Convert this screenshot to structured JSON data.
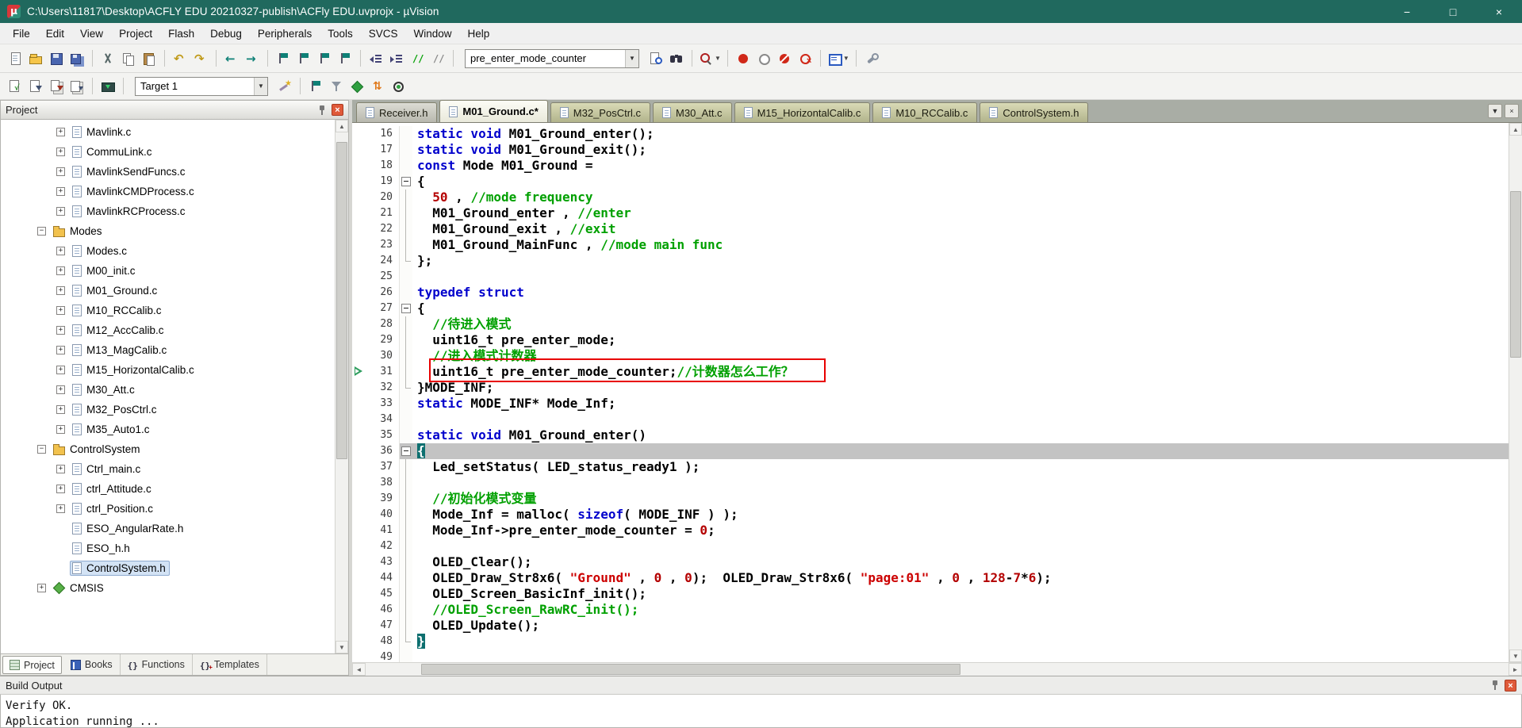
{
  "window": {
    "title": "C:\\Users\\11817\\Desktop\\ACFLY EDU 20210327-publish\\ACFly EDU.uvprojx - µVision",
    "app_glyph": "µ",
    "controls": {
      "minimize": "−",
      "maximize": "□",
      "close": "×"
    }
  },
  "glyphs": {
    "dropdown": "▼",
    "up_arrow": "▲",
    "down_arrow": "▼",
    "left_arrow": "◄",
    "right_arrow": "►",
    "close_small": "×"
  },
  "menu": [
    "File",
    "Edit",
    "View",
    "Project",
    "Flash",
    "Debug",
    "Peripherals",
    "Tools",
    "SVCS",
    "Window",
    "Help"
  ],
  "toolbar_main": {
    "groups_left": [
      [
        "new-file",
        "open-file",
        "save",
        "save-all"
      ],
      [
        "cut",
        "copy",
        "paste"
      ],
      [
        "undo",
        "redo"
      ],
      [
        "navigate-back",
        "navigate-forward"
      ],
      [
        "bookmark-toggle",
        "bookmark-prev",
        "bookmark-next",
        "bookmark-clear"
      ],
      [
        "unindent",
        "indent",
        "comment",
        "uncomment"
      ]
    ],
    "symbol_box": {
      "value": "pre_enter_mode_counter"
    },
    "groups_right": [
      [
        "find-in-files",
        "binoculars"
      ],
      [
        "incremental-find"
      ],
      [
        "breakpoint-toggle",
        "breakpoint-enable",
        "breakpoint-disable-all",
        "breakpoint-kill-all"
      ],
      [
        "memory-window"
      ],
      [
        "configure-tools"
      ]
    ]
  },
  "toolbar_build": {
    "groups_left": [
      [
        "translate",
        "build",
        "rebuild",
        "batch-build"
      ],
      [
        "load"
      ]
    ],
    "target_box": {
      "value": "Target 1"
    },
    "groups_right": [
      [
        "options-wand"
      ],
      [
        "file-extensions-flag",
        "filter",
        "debug-diamond",
        "swap-arrows",
        "debug-target"
      ]
    ]
  },
  "project_panel": {
    "title": "Project",
    "tree": [
      {
        "label": "Mavlink.c",
        "depth": 2,
        "icon": "doc",
        "expander": "plus"
      },
      {
        "label": "CommuLink.c",
        "depth": 2,
        "icon": "doc",
        "expander": "plus"
      },
      {
        "label": "MavlinkSendFuncs.c",
        "depth": 2,
        "icon": "doc",
        "expander": "plus"
      },
      {
        "label": "MavlinkCMDProcess.c",
        "depth": 2,
        "icon": "doc",
        "expander": "plus"
      },
      {
        "label": "MavlinkRCProcess.c",
        "depth": 2,
        "icon": "doc",
        "expander": "plus"
      },
      {
        "label": "Modes",
        "depth": 1,
        "icon": "folder",
        "expander": "minus"
      },
      {
        "label": "Modes.c",
        "depth": 2,
        "icon": "doc",
        "expander": "plus"
      },
      {
        "label": "M00_init.c",
        "depth": 2,
        "icon": "doc",
        "expander": "plus"
      },
      {
        "label": "M01_Ground.c",
        "depth": 2,
        "icon": "doc",
        "expander": "plus"
      },
      {
        "label": "M10_RCCalib.c",
        "depth": 2,
        "icon": "doc",
        "expander": "plus"
      },
      {
        "label": "M12_AccCalib.c",
        "depth": 2,
        "icon": "doc",
        "expander": "plus"
      },
      {
        "label": "M13_MagCalib.c",
        "depth": 2,
        "icon": "doc",
        "expander": "plus"
      },
      {
        "label": "M15_HorizontalCalib.c",
        "depth": 2,
        "icon": "doc",
        "expander": "plus"
      },
      {
        "label": "M30_Att.c",
        "depth": 2,
        "icon": "doc",
        "expander": "plus"
      },
      {
        "label": "M32_PosCtrl.c",
        "depth": 2,
        "icon": "doc",
        "expander": "plus"
      },
      {
        "label": "M35_Auto1.c",
        "depth": 2,
        "icon": "doc",
        "expander": "plus"
      },
      {
        "label": "ControlSystem",
        "depth": 1,
        "icon": "folder",
        "expander": "minus"
      },
      {
        "label": "Ctrl_main.c",
        "depth": 2,
        "icon": "doc",
        "expander": "plus"
      },
      {
        "label": "ctrl_Attitude.c",
        "depth": 2,
        "icon": "doc",
        "expander": "plus"
      },
      {
        "label": "ctrl_Position.c",
        "depth": 2,
        "icon": "doc",
        "expander": "plus"
      },
      {
        "label": "ESO_AngularRate.h",
        "depth": 2,
        "icon": "doc",
        "expander": "none"
      },
      {
        "label": "ESO_h.h",
        "depth": 2,
        "icon": "doc",
        "expander": "none"
      },
      {
        "label": "ControlSystem.h",
        "depth": 2,
        "icon": "doc",
        "expander": "none",
        "selected": true
      },
      {
        "label": "CMSIS",
        "depth": 1,
        "icon": "cmsis",
        "expander": "plus"
      }
    ],
    "workspace_tabs": [
      {
        "label": "Project",
        "icon": "project",
        "active": true
      },
      {
        "label": "Books",
        "icon": "books"
      },
      {
        "label": "Functions",
        "icon": "functions"
      },
      {
        "label": "Templates",
        "icon": "templates"
      }
    ]
  },
  "editor": {
    "tabs": [
      {
        "label": "Receiver.h",
        "style": "gray"
      },
      {
        "label": "M01_Ground.c*",
        "style": "active"
      },
      {
        "label": "M32_PosCtrl.c",
        "style": "olive"
      },
      {
        "label": "M30_Att.c",
        "style": "olive"
      },
      {
        "label": "M15_HorizontalCalib.c",
        "style": "olive"
      },
      {
        "label": "M10_RCCalib.c",
        "style": "olive"
      },
      {
        "label": "ControlSystem.h",
        "style": "olive"
      }
    ],
    "current_line": 36,
    "annotated_line": 31,
    "code": [
      {
        "n": 16,
        "f": "",
        "seg": [
          [
            "k",
            "static void"
          ],
          [
            "p",
            " M01_Ground_enter();"
          ]
        ]
      },
      {
        "n": 17,
        "f": "",
        "seg": [
          [
            "k",
            "static void"
          ],
          [
            "p",
            " M01_Ground_exit();"
          ]
        ]
      },
      {
        "n": 18,
        "f": "",
        "seg": [
          [
            "k",
            "const"
          ],
          [
            "p",
            " Mode M01_Ground = "
          ]
        ]
      },
      {
        "n": 19,
        "f": "s",
        "seg": [
          [
            "p",
            "{"
          ]
        ]
      },
      {
        "n": 20,
        "f": "m",
        "seg": [
          [
            "p",
            "  "
          ],
          [
            "n",
            "50"
          ],
          [
            "p",
            " , "
          ],
          [
            "c",
            "//mode frequency"
          ]
        ]
      },
      {
        "n": 21,
        "f": "m",
        "seg": [
          [
            "p",
            "  M01_Ground_enter , "
          ],
          [
            "c",
            "//enter"
          ]
        ]
      },
      {
        "n": 22,
        "f": "m",
        "seg": [
          [
            "p",
            "  M01_Ground_exit , "
          ],
          [
            "c",
            "//exit"
          ]
        ]
      },
      {
        "n": 23,
        "f": "m",
        "seg": [
          [
            "p",
            "  M01_Ground_MainFunc , "
          ],
          [
            "c",
            "//mode main func"
          ]
        ]
      },
      {
        "n": 24,
        "f": "e",
        "seg": [
          [
            "p",
            "};"
          ]
        ]
      },
      {
        "n": 25,
        "f": "",
        "seg": []
      },
      {
        "n": 26,
        "f": "",
        "seg": [
          [
            "k",
            "typedef struct"
          ]
        ]
      },
      {
        "n": 27,
        "f": "s",
        "seg": [
          [
            "p",
            "{"
          ]
        ]
      },
      {
        "n": 28,
        "f": "m",
        "seg": [
          [
            "p",
            "  "
          ],
          [
            "c",
            "//待进入模式"
          ]
        ]
      },
      {
        "n": 29,
        "f": "m",
        "seg": [
          [
            "p",
            "  uint16_t pre_enter_mode;"
          ]
        ]
      },
      {
        "n": 30,
        "f": "m",
        "seg": [
          [
            "p",
            "  "
          ],
          [
            "c",
            "//进入模式计数器"
          ]
        ]
      },
      {
        "n": 31,
        "f": "m",
        "seg": [
          [
            "p",
            "  uint16_t pre_enter_mode_counter;"
          ],
          [
            "c",
            "//计数器怎么工作？"
          ]
        ]
      },
      {
        "n": 32,
        "f": "e",
        "seg": [
          [
            "p",
            "}MODE_INF;"
          ]
        ]
      },
      {
        "n": 33,
        "f": "",
        "seg": [
          [
            "k",
            "static"
          ],
          [
            "p",
            " MODE_INF* Mode_Inf;"
          ]
        ]
      },
      {
        "n": 34,
        "f": "",
        "seg": []
      },
      {
        "n": 35,
        "f": "",
        "seg": [
          [
            "k",
            "static void"
          ],
          [
            "p",
            " M01_Ground_enter()"
          ]
        ]
      },
      {
        "n": 36,
        "f": "s",
        "seg": [
          [
            "bh",
            "{"
          ]
        ]
      },
      {
        "n": 37,
        "f": "m",
        "seg": [
          [
            "p",
            "  Led_setStatus( LED_status_ready1 );"
          ]
        ]
      },
      {
        "n": 38,
        "f": "m",
        "seg": []
      },
      {
        "n": 39,
        "f": "m",
        "seg": [
          [
            "p",
            "  "
          ],
          [
            "c",
            "//初始化模式变量"
          ]
        ]
      },
      {
        "n": 40,
        "f": "m",
        "seg": [
          [
            "p",
            "  Mode_Inf = malloc( "
          ],
          [
            "k",
            "sizeof"
          ],
          [
            "p",
            "( MODE_INF ) );"
          ]
        ]
      },
      {
        "n": 41,
        "f": "m",
        "seg": [
          [
            "p",
            "  Mode_Inf->pre_enter_mode_counter = "
          ],
          [
            "n",
            "0"
          ],
          [
            "p",
            ";"
          ]
        ]
      },
      {
        "n": 42,
        "f": "m",
        "seg": []
      },
      {
        "n": 43,
        "f": "m",
        "seg": [
          [
            "p",
            "  OLED_Clear();"
          ]
        ]
      },
      {
        "n": 44,
        "f": "m",
        "seg": [
          [
            "p",
            "  OLED_Draw_Str8x6( "
          ],
          [
            "s",
            "\"Ground\""
          ],
          [
            "p",
            " , "
          ],
          [
            "n",
            "0"
          ],
          [
            "p",
            " , "
          ],
          [
            "n",
            "0"
          ],
          [
            "p",
            ");  OLED_Draw_Str8x6( "
          ],
          [
            "s",
            "\"page:01\""
          ],
          [
            "p",
            " , "
          ],
          [
            "n",
            "0"
          ],
          [
            "p",
            " , "
          ],
          [
            "n",
            "128"
          ],
          [
            "p",
            "-"
          ],
          [
            "n",
            "7"
          ],
          [
            "p",
            "*"
          ],
          [
            "n",
            "6"
          ],
          [
            "p",
            ");"
          ]
        ]
      },
      {
        "n": 45,
        "f": "m",
        "seg": [
          [
            "p",
            "  OLED_Screen_BasicInf_init();"
          ]
        ]
      },
      {
        "n": 46,
        "f": "m",
        "seg": [
          [
            "p",
            "  "
          ],
          [
            "c",
            "//OLED_Screen_RawRC_init();"
          ]
        ]
      },
      {
        "n": 47,
        "f": "m",
        "seg": [
          [
            "p",
            "  OLED_Update();"
          ]
        ]
      },
      {
        "n": 48,
        "f": "e",
        "seg": [
          [
            "bh",
            "}"
          ]
        ]
      },
      {
        "n": 49,
        "f": "",
        "seg": []
      }
    ]
  },
  "build_output": {
    "title": "Build Output",
    "lines": [
      "Verify OK.",
      "Application running ..."
    ]
  }
}
